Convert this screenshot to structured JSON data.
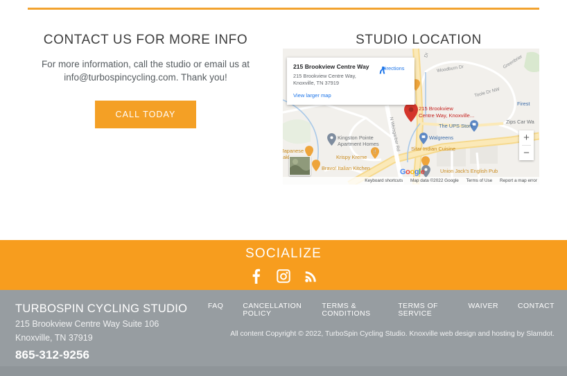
{
  "contact": {
    "title": "CONTACT US FOR MORE INFO",
    "lead_line1": "For more information, call the studio or email us at",
    "lead_line2": "info@turbospincycling.com. Thank you!",
    "call_button": "CALL TODAY"
  },
  "location": {
    "title": "STUDIO LOCATION",
    "card": {
      "title": "215 Brookview Centre Way",
      "address": "215 Brookview Centre Way, Knoxville, TN 37919",
      "view_larger": "View larger map",
      "directions": "Directions"
    },
    "marker_label_line1": "215 Brookview",
    "marker_label_line2": "Centre Way, Knoxville...",
    "pois": [
      "Kingston Pointe",
      "Apartment Homes",
      "The UPS Store",
      "Walgreens",
      "Sitar Indian Cuisine",
      "Krispy Kreme",
      "Bravo! Italian Kitchen",
      "Union Jack's English Pub",
      "Zips Car Wa",
      "Firest",
      "Japanese",
      "eakhouse"
    ],
    "poi_kingston_1": "Kingston Pointe",
    "poi_kingston_2": "Apartment Homes",
    "poi_ups": "The UPS Store",
    "poi_walgreens": "Walgreens",
    "poi_sitar": "Sitar Indian Cuisine",
    "poi_krispy": "Krispy Kreme",
    "poi_bravo": "Bravo! Italian Kitchen",
    "poi_unionjack": "Union Jack's English Pub",
    "poi_zips": "Zips Car Wa",
    "poi_firestone": "Firest",
    "poi_japanese_1": "Japanese",
    "poi_japanese_2": "eakhouse",
    "streets": {
      "woodburn": "Woodburn Dr",
      "toole": "Toole Dr NW",
      "greenbrier": "Greenbrier",
      "weisgarber": "N Weisgarber Rd",
      "topdr": "Dr"
    },
    "attribution": {
      "keyboard": "Keyboard shortcuts",
      "mapdata": "Map data ©2022 Google",
      "terms": "Terms of Use",
      "report": "Report a map error"
    },
    "zoom_in": "+",
    "zoom_out": "−",
    "google_logo": "Google"
  },
  "socialize": {
    "title": "SOCIALIZE",
    "icons": [
      "facebook-icon",
      "instagram-icon",
      "rss-icon"
    ]
  },
  "footer": {
    "company": "TURBOSPIN CYCLING STUDIO",
    "address_line1": "215 Brookview Centre Way Suite 106",
    "address_line2": "Knoxville, TN 37919",
    "phone": "865-312-9256",
    "links": [
      "FAQ",
      "CANCELLATION POLICY",
      "TERMS & CONDITIONS",
      "TERMS OF SERVICE",
      "WAIVER",
      "CONTACT"
    ],
    "copyright": "All content Copyright © 2022, TurboSpin Cycling Studio. Knoxville web design and hosting by Slamdot."
  },
  "colors": {
    "accent_orange": "#f79d1e",
    "button_orange": "#f4a025",
    "divider_orange": "#f2a22e",
    "footer_gray": "#979da1",
    "footer_strip_gray": "#8f9599",
    "heading_gray": "#3c3c3c"
  }
}
